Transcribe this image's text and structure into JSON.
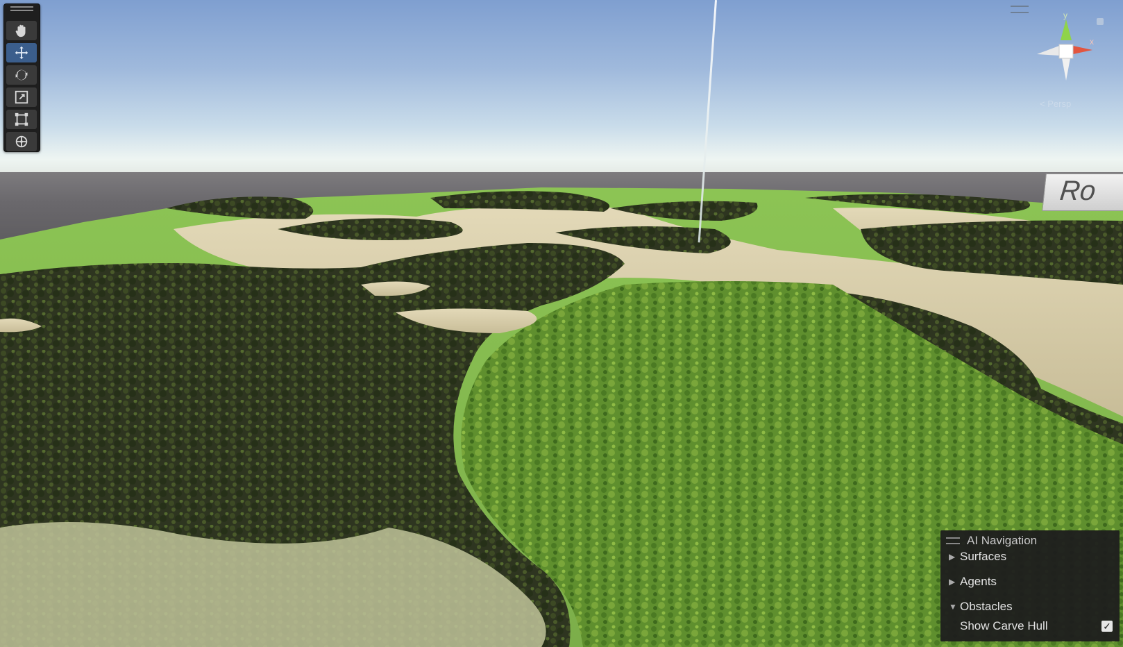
{
  "viewport": {
    "type": "scene-view"
  },
  "toolbar": {
    "tools": [
      {
        "name": "hand-tool",
        "icon": "hand-icon",
        "active": false
      },
      {
        "name": "move-tool",
        "icon": "move-arrows-icon",
        "active": true
      },
      {
        "name": "rotate-tool",
        "icon": "rotate-icon",
        "active": false
      },
      {
        "name": "scale-tool",
        "icon": "scale-icon",
        "active": false
      },
      {
        "name": "rect-tool",
        "icon": "rect-transform-icon",
        "active": false
      },
      {
        "name": "transform-tool",
        "icon": "transform-icon",
        "active": false
      }
    ]
  },
  "gizmo": {
    "y_label": "y",
    "x_label": "x",
    "projection": "Persp"
  },
  "sign": {
    "text": "Ro"
  },
  "ai_navigation": {
    "title": "AI Navigation",
    "items": [
      {
        "label": "Surfaces",
        "expanded": false
      },
      {
        "label": "Agents",
        "expanded": false
      },
      {
        "label": "Obstacles",
        "expanded": true
      }
    ],
    "show_carve_hull": {
      "label": "Show Carve Hull",
      "checked": true,
      "check_glyph": "✓"
    }
  },
  "colors": {
    "active_tool": "#3b5e8c",
    "panel_bg": "#1e1e1e",
    "axis_x": "#e2553f",
    "axis_y": "#8fd34a"
  }
}
